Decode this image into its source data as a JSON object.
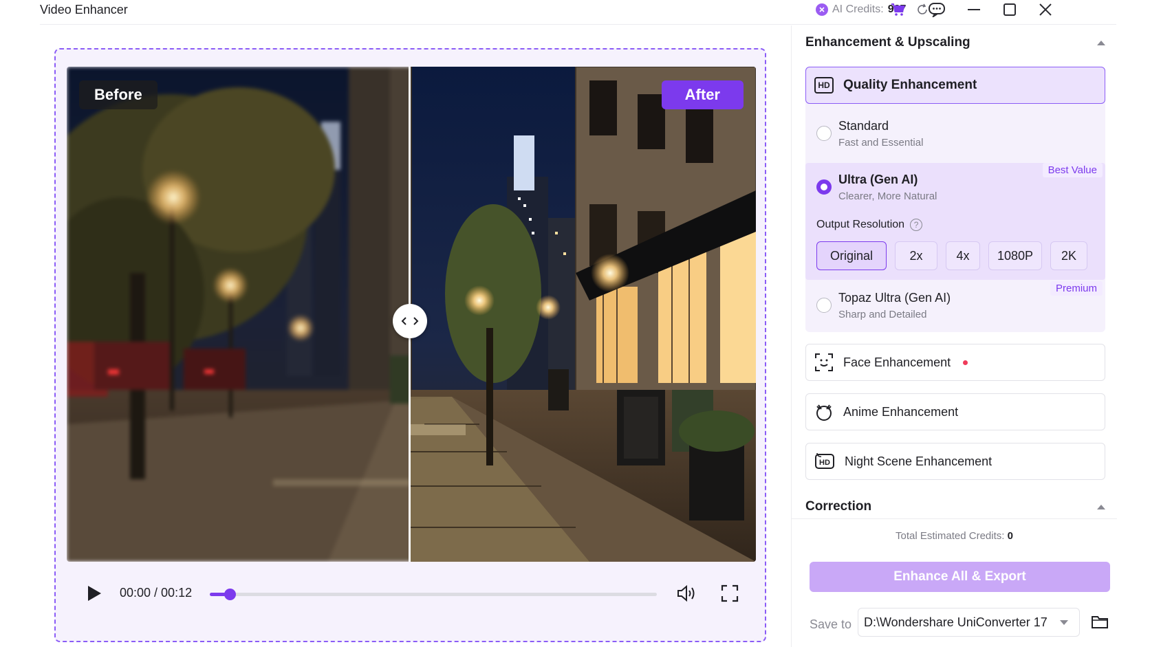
{
  "window": {
    "title": "Video Enhancer"
  },
  "titlebar": {
    "credits_label": "AI Credits:",
    "credits_value": "987",
    "icons": [
      "refresh-icon",
      "cart-icon",
      "feedback-icon",
      "minimize-icon",
      "maximize-icon",
      "close-icon"
    ]
  },
  "preview": {
    "before_label": "Before",
    "after_label": "After",
    "player": {
      "time": "00:00 / 00:12",
      "progress_fraction": 0.045
    }
  },
  "panel": {
    "section_enhancement": "Enhancement & Upscaling",
    "quality": {
      "title": "Quality Enhancement",
      "options": [
        {
          "title": "Standard",
          "subtitle": "Fast and Essential",
          "selected": false,
          "tag": ""
        },
        {
          "title": "Ultra (Gen AI)",
          "subtitle": "Clearer, More Natural",
          "selected": true,
          "tag": "Best Value"
        },
        {
          "title": "Topaz Ultra (Gen AI)",
          "subtitle": "Sharp and Detailed",
          "selected": false,
          "tag": "Premium"
        }
      ],
      "output_resolution_label": "Output Resolution",
      "resolutions": [
        "Original",
        "2x",
        "4x",
        "1080P",
        "2K"
      ],
      "selected_resolution": "Original"
    },
    "features": [
      {
        "label": "Face Enhancement",
        "icon": "face-scan-icon",
        "new_dot": true
      },
      {
        "label": "Anime Enhancement",
        "icon": "anime-face-icon",
        "new_dot": false
      },
      {
        "label": "Night Scene Enhancement",
        "icon": "hd-night-icon",
        "new_dot": false
      }
    ],
    "section_correction": "Correction",
    "footer": {
      "estimated_label": "Total Estimated Credits:",
      "estimated_value": "0",
      "export_label": "Enhance All & Export",
      "save_to_label": "Save to",
      "save_path": "D:\\Wondershare UniConverter 17"
    }
  },
  "colors": {
    "accent": "#7c3aed",
    "accent_light": "#ece2fd",
    "export_disabled": "#c9a8f7",
    "dot": "#ef3b5a"
  }
}
